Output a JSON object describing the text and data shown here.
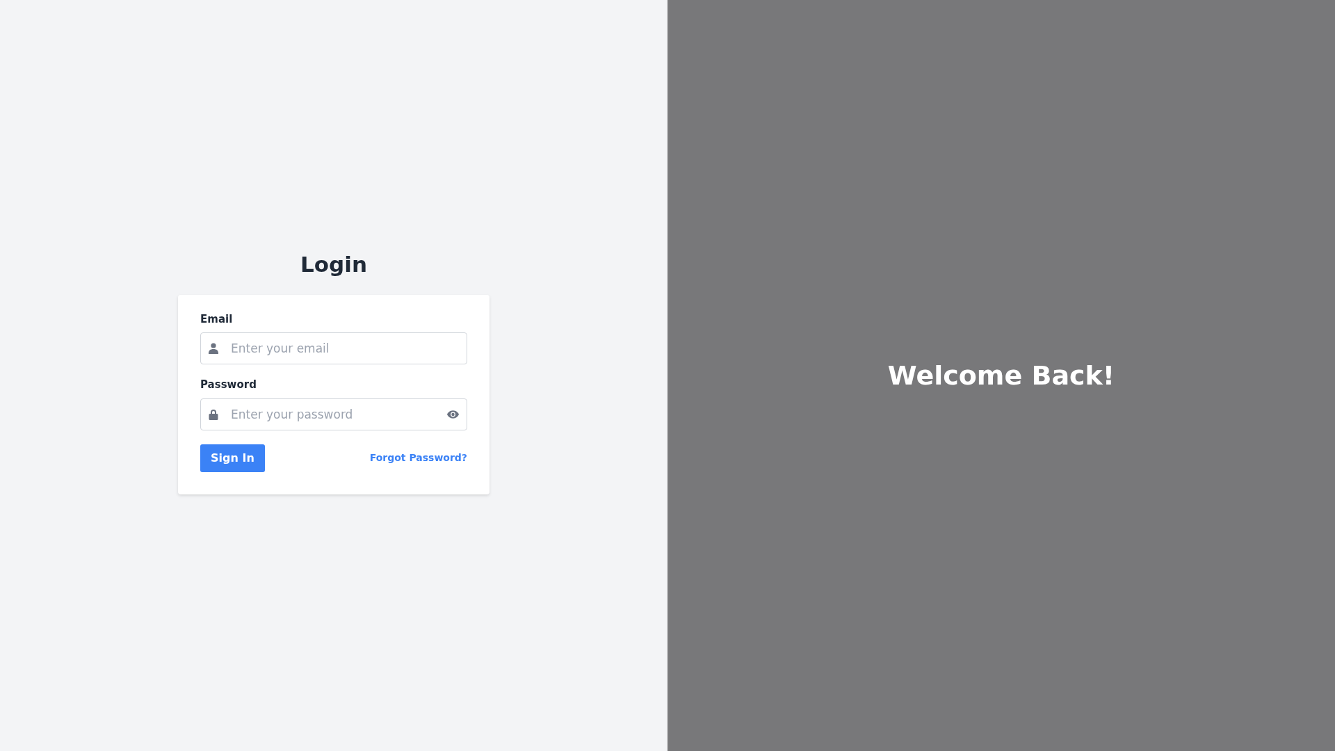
{
  "login": {
    "title": "Login",
    "fields": [
      {
        "kind": "email",
        "label": "Email",
        "placeholder": "Enter your email"
      },
      {
        "kind": "password",
        "label": "Password",
        "placeholder": "Enter your password"
      }
    ],
    "submit": "Sign In",
    "forgot_link": "Forgot Password?"
  },
  "hero": {
    "heading": "Welcome Back!"
  }
}
